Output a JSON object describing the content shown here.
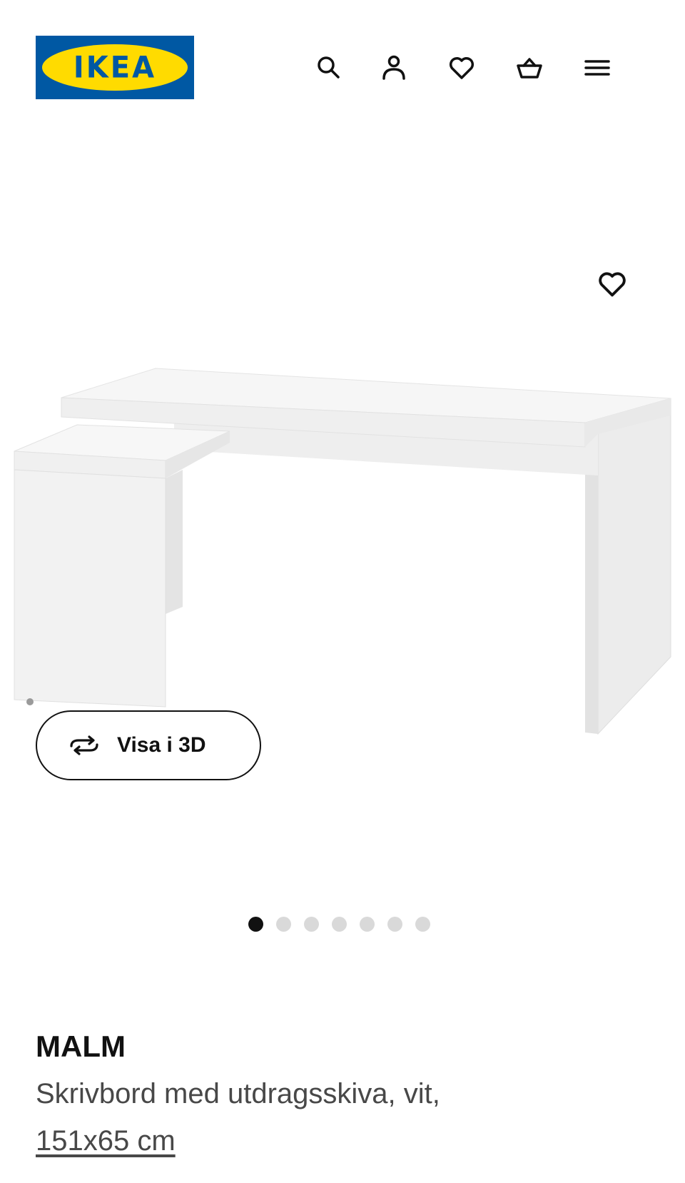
{
  "header": {
    "logo_text": "IKEA",
    "logo_reg": "®",
    "brand_colors": {
      "blue": "#0058a3",
      "yellow": "#ffdb00"
    },
    "icons": [
      "search-icon",
      "account-icon",
      "favourites-icon",
      "basket-icon",
      "menu-icon"
    ]
  },
  "gallery": {
    "favourite_icon": "heart-icon",
    "view_3d_label": "Visa i 3D",
    "view_3d_icon": "rotate-3d-icon",
    "total_images": 7,
    "active_index": 0
  },
  "product": {
    "name": "MALM",
    "description": "Skrivbord med utdragsskiva, vit,",
    "size": "151x65 cm"
  }
}
